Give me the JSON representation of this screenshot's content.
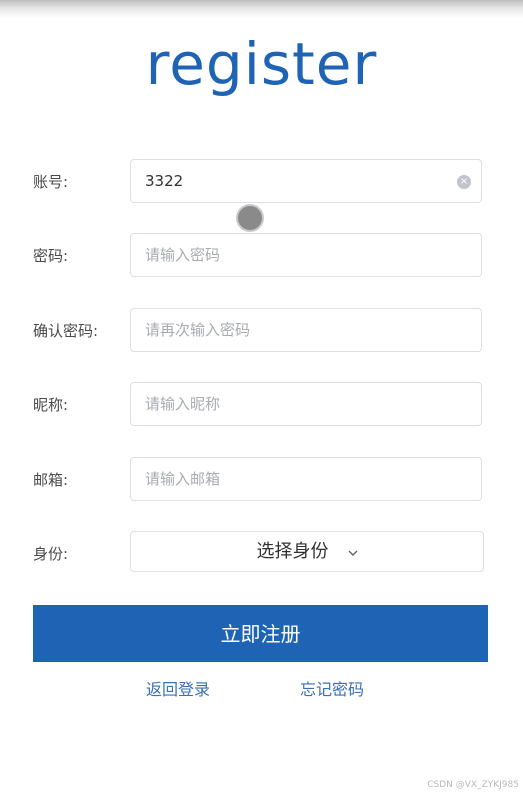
{
  "title": "register",
  "form": {
    "account": {
      "label": "账号:",
      "value": "3322"
    },
    "password": {
      "label": "密码:",
      "placeholder": "请输入密码"
    },
    "confirm": {
      "label": "确认密码:",
      "placeholder": "请再次输入密码"
    },
    "nickname": {
      "label": "昵称:",
      "placeholder": "请输入昵称"
    },
    "email": {
      "label": "邮箱:",
      "placeholder": "请输入邮箱"
    },
    "identity": {
      "label": "身份:",
      "placeholder": "选择身份"
    }
  },
  "submit_label": "立即注册",
  "links": {
    "back_login": "返回登录",
    "forgot_password": "忘记密码"
  },
  "watermark": "CSDN @VX_ZYKJ985",
  "colors": {
    "primary": "#1f63b4",
    "link": "#3a6fb7"
  }
}
